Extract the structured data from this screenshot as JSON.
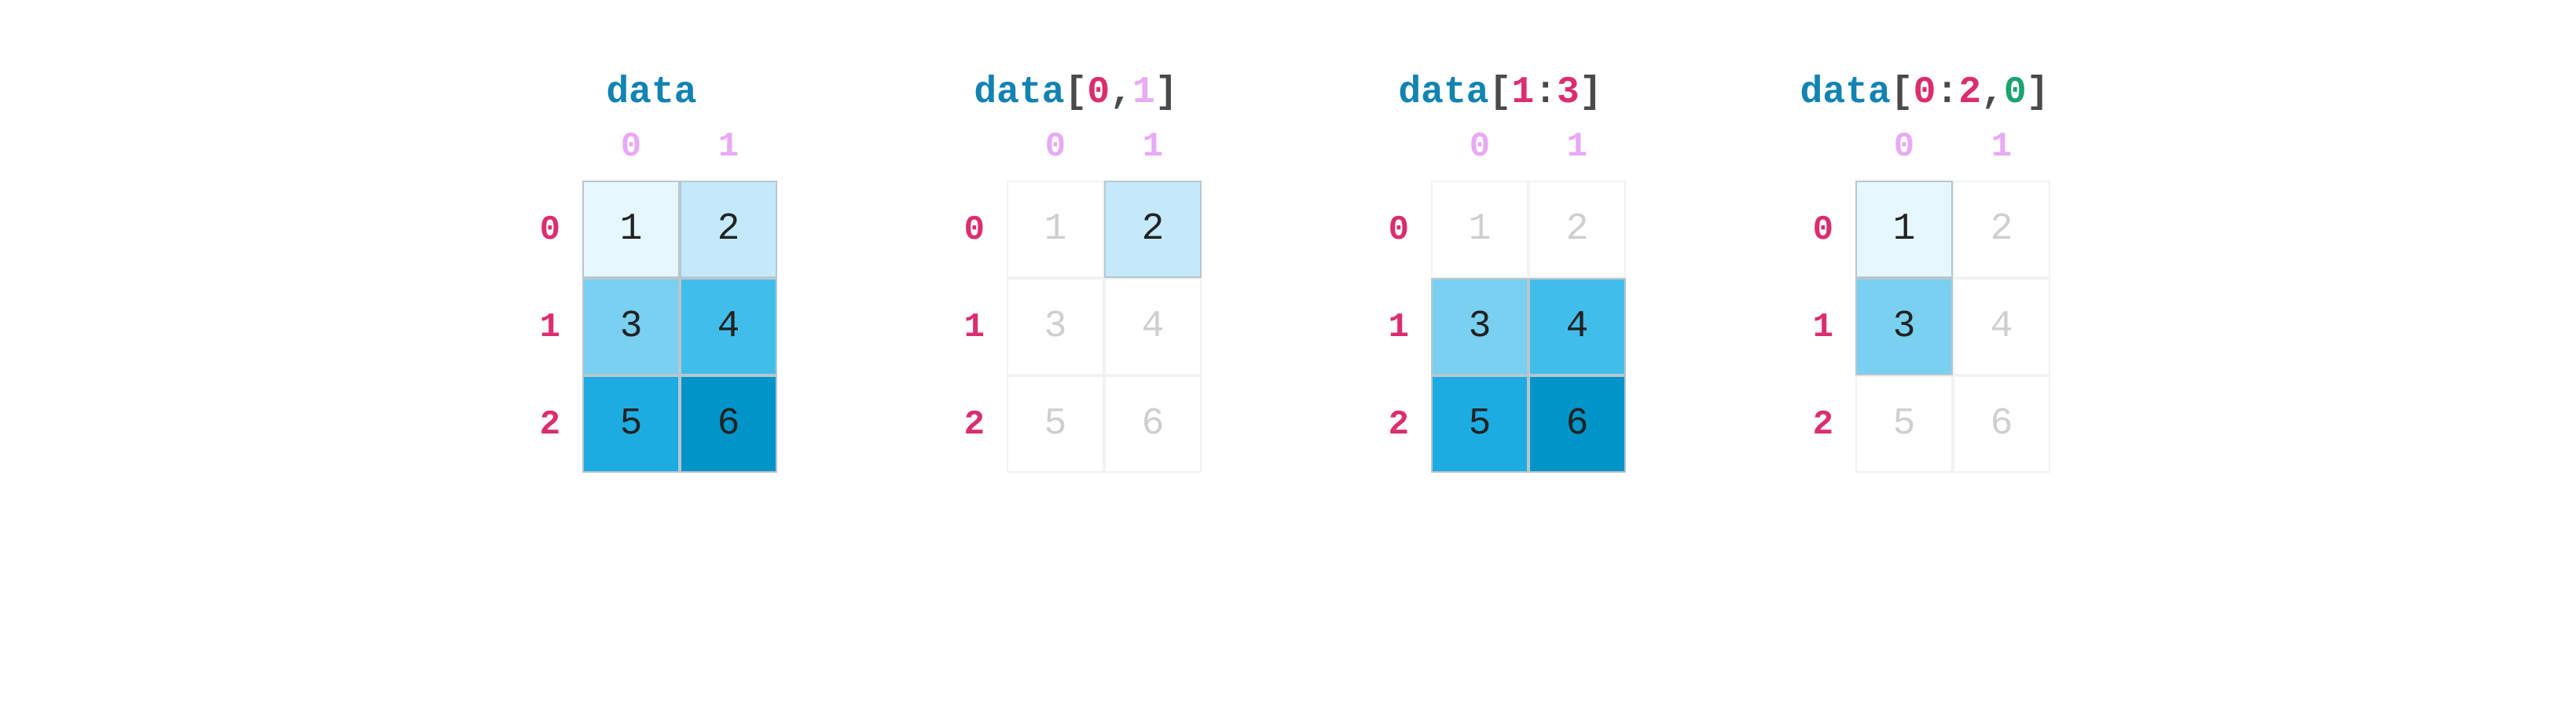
{
  "col_labels": [
    "0",
    "1"
  ],
  "row_labels": [
    "0",
    "1",
    "2"
  ],
  "cell_values": [
    "1",
    "2",
    "3",
    "4",
    "5",
    "6"
  ],
  "cell_colors": [
    "#e6f7fe",
    "#c3e9fa",
    "#79d0f0",
    "#40bee9",
    "#1cace1",
    "#0194c8"
  ],
  "panels": [
    {
      "title_parts": [
        {
          "text": "data",
          "cls": "t-var"
        }
      ],
      "selected": [
        true,
        true,
        true,
        true,
        true,
        true
      ]
    },
    {
      "title_parts": [
        {
          "text": "data",
          "cls": "t-var"
        },
        {
          "text": "[",
          "cls": "t-brack"
        },
        {
          "text": "0",
          "cls": "t-pink"
        },
        {
          "text": ",",
          "cls": "t-brack"
        },
        {
          "text": "1",
          "cls": "t-vio"
        },
        {
          "text": "]",
          "cls": "t-brack"
        }
      ],
      "selected": [
        false,
        true,
        false,
        false,
        false,
        false
      ]
    },
    {
      "title_parts": [
        {
          "text": "data",
          "cls": "t-var"
        },
        {
          "text": "[",
          "cls": "t-brack"
        },
        {
          "text": "1",
          "cls": "t-pink"
        },
        {
          "text": ":",
          "cls": "t-brack"
        },
        {
          "text": "3",
          "cls": "t-pink"
        },
        {
          "text": "]",
          "cls": "t-brack"
        }
      ],
      "selected": [
        false,
        false,
        true,
        true,
        true,
        true
      ]
    },
    {
      "title_parts": [
        {
          "text": "data",
          "cls": "t-var"
        },
        {
          "text": "[",
          "cls": "t-brack"
        },
        {
          "text": "0",
          "cls": "t-pink"
        },
        {
          "text": ":",
          "cls": "t-brack"
        },
        {
          "text": "2",
          "cls": "t-pink"
        },
        {
          "text": ",",
          "cls": "t-brack"
        },
        {
          "text": "0",
          "cls": "t-green"
        },
        {
          "text": "]",
          "cls": "t-brack"
        }
      ],
      "selected": [
        true,
        false,
        true,
        false,
        false,
        false
      ]
    }
  ]
}
